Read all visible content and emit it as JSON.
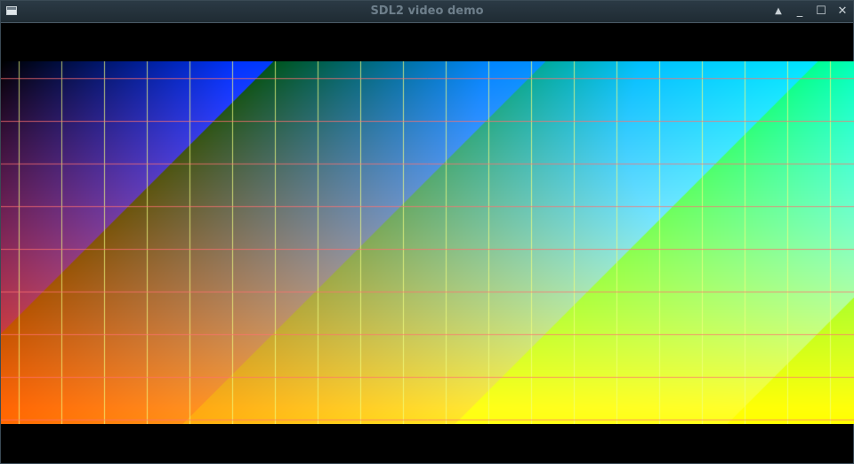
{
  "window": {
    "title": "SDL2 video demo",
    "icon": "window-app-icon",
    "controls": {
      "shade": {
        "icon": "shade-up-icon",
        "glyph": "▲"
      },
      "minimize": {
        "icon": "minimize-icon",
        "glyph": "_"
      },
      "maximize": {
        "icon": "maximize-icon",
        "glyph": "☐"
      },
      "close": {
        "icon": "close-icon",
        "glyph": "✕"
      }
    }
  },
  "colors": {
    "titlebar": "#1f2b33",
    "title_text": "#6e7f8b",
    "letterbox": "#000000",
    "grid_vertical": "#f0ff80",
    "grid_horizontal": "#ff7070"
  }
}
